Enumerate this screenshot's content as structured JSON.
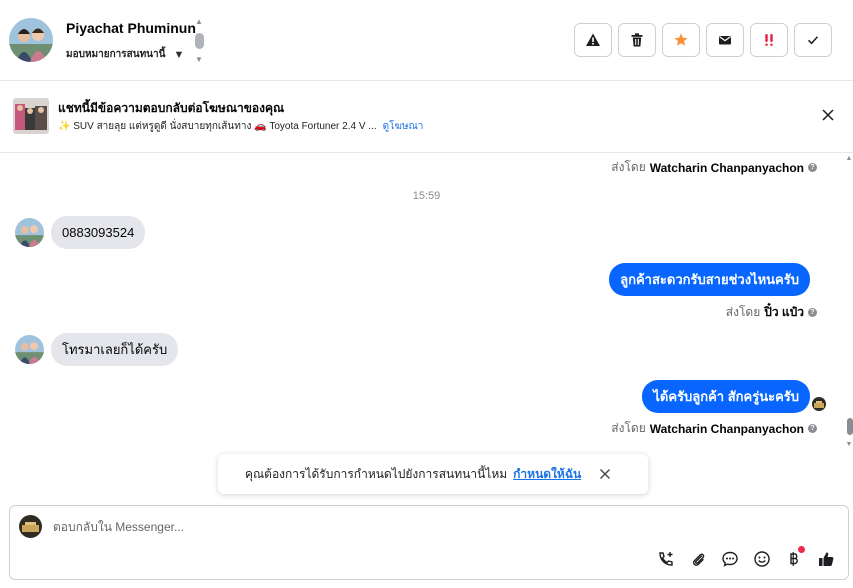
{
  "header": {
    "contact_name": "Piyachat Phuminun",
    "assign_label": "มอบหมายการสนทนานี้",
    "actions": [
      {
        "name": "report-button",
        "icon": "warning-icon",
        "color": "#1c1e21"
      },
      {
        "name": "delete-button",
        "icon": "trash-icon",
        "color": "#1c1e21"
      },
      {
        "name": "star-button",
        "icon": "star-icon",
        "color": "#f7923b"
      },
      {
        "name": "mark-unread-button",
        "icon": "envelope-icon",
        "color": "#1c1e21"
      },
      {
        "name": "follow-up-button",
        "icon": "double-exclamation-icon",
        "color": "#e41e3f"
      },
      {
        "name": "mark-done-button",
        "icon": "checkmark-icon",
        "color": "#1c1e21"
      }
    ]
  },
  "ad_banner": {
    "title": "แชทนี้มีข้อความตอบกลับต่อโฆษณาของคุณ",
    "description": "✨ SUV สายลุย แต่หรูดูดี นั่งสบายทุกเส้นทาง 🚗 Toyota Fortuner 2.4 V ...",
    "view_ad_label": "ดูโฆษณา"
  },
  "thread": {
    "top_sent_by": {
      "prefix": "ส่งโดย",
      "name": "Watcharin Chanpanyachon"
    },
    "timestamp": "15:59",
    "messages": [
      {
        "direction": "in",
        "text": "0883093524"
      },
      {
        "direction": "out",
        "text": "ลูกค้าสะดวกรับสายช่วงไหนครับ",
        "sent_by_prefix": "ส่งโดย",
        "sent_by_name": "ปิ๋ว แป๋ว"
      },
      {
        "direction": "in",
        "text": "โทรมาเลยก็ได้ครับ"
      },
      {
        "direction": "out",
        "text": "ได้ครับลูกค้า สักครู่นะครับ",
        "sent_by_prefix": "ส่งโดย",
        "sent_by_name": "Watcharin Chanpanyachon"
      }
    ]
  },
  "toast": {
    "text": "คุณต้องการได้รับการกำหนดไปยังการสนทนานี้ไหม",
    "link_label": "กำหนดให้ฉัน"
  },
  "composer": {
    "placeholder": "ตอบกลับใน Messenger...",
    "tools": [
      "call-icon",
      "attachment-icon",
      "saved-reply-icon",
      "emoji-icon",
      "baht-icon",
      "thumbs-up-icon"
    ]
  },
  "colors": {
    "outgoing_bubble": "#0866ff",
    "incoming_bubble": "#e4e6eb",
    "link": "#1b74e4",
    "notification_dot": "#f02849"
  }
}
